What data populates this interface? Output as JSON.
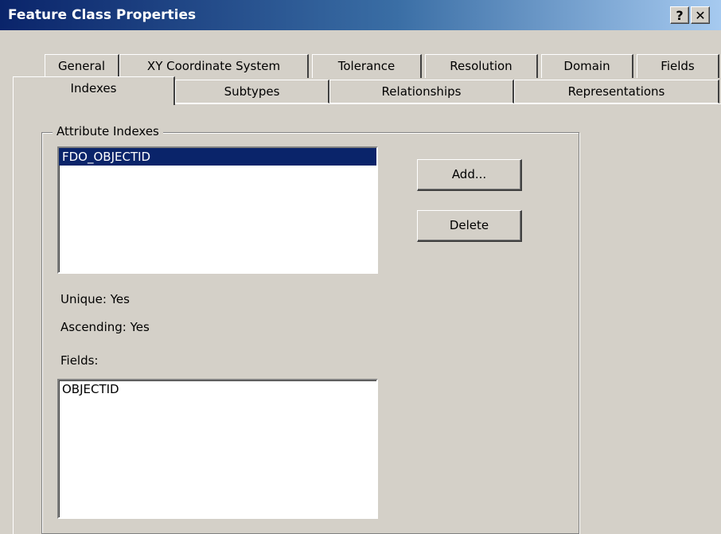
{
  "window": {
    "title": "Feature Class Properties",
    "help_button": "?",
    "close_button": "✕"
  },
  "tabs_row1": [
    {
      "label": "General"
    },
    {
      "label": "XY Coordinate System"
    },
    {
      "label": "Tolerance"
    },
    {
      "label": "Resolution"
    },
    {
      "label": "Domain"
    },
    {
      "label": "Fields"
    }
  ],
  "tabs_row2": [
    {
      "label": "Indexes",
      "active": true
    },
    {
      "label": "Subtypes"
    },
    {
      "label": "Relationships"
    },
    {
      "label": "Representations"
    }
  ],
  "attribute_indexes": {
    "group_label": "Attribute Indexes",
    "items": [
      "FDO_OBJECTID"
    ],
    "selected": "FDO_OBJECTID",
    "add_label": "Add...",
    "delete_label": "Delete",
    "unique_text": "Unique: Yes",
    "ascending_text": "Ascending: Yes",
    "fields_label": "Fields:",
    "fields": [
      "OBJECTID"
    ]
  },
  "colors": {
    "dialog_bg": "#d4d0c8",
    "title_bar": "#0a246a",
    "selection": "#0a246a"
  }
}
